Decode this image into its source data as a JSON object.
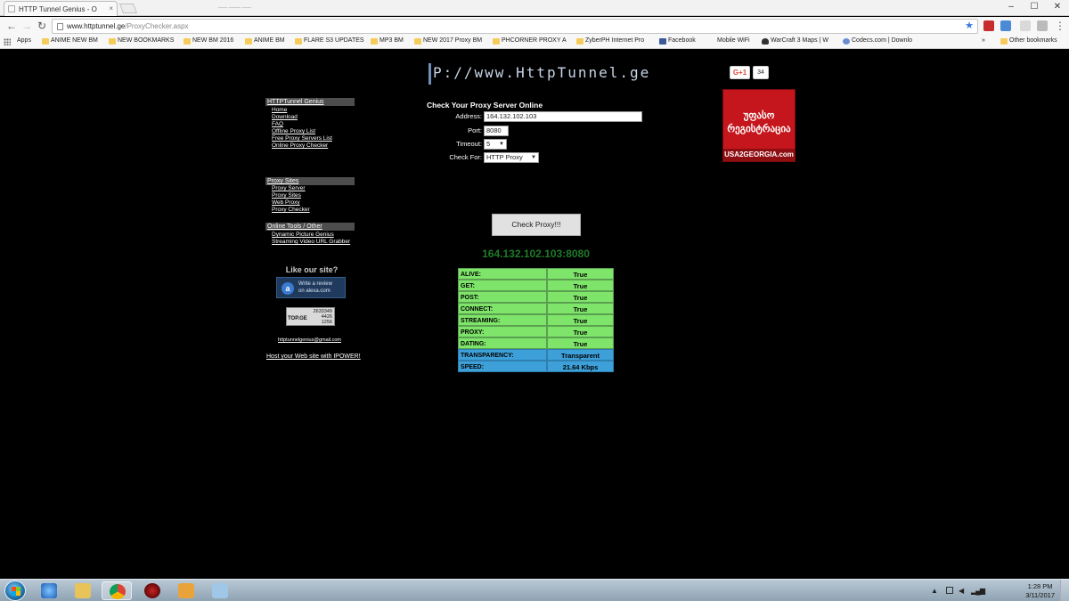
{
  "browser": {
    "tab_title": "HTTP Tunnel Genius - O",
    "tab_close": "×",
    "ghost_tab": "___ ____ ___",
    "window_min": "–",
    "window_max": "☐",
    "window_close": "✕",
    "url_host": "www.httptunnel.ge",
    "url_path": "/ProxyChecker.aspx",
    "back": "←",
    "forward": "→",
    "reload": "↻",
    "star": "★",
    "menu": "⋮"
  },
  "bookmarks": {
    "apps": "Apps",
    "items": [
      {
        "label": "ANIME NEW BM"
      },
      {
        "label": "NEW BOOKMARKS"
      },
      {
        "label": "NEW BM 2016"
      },
      {
        "label": "ANIME BM"
      },
      {
        "label": "FLARE S3 UPDATES"
      },
      {
        "label": "MP3 BM"
      },
      {
        "label": "NEW 2017 Proxy BM"
      },
      {
        "label": "PHCORNER PROXY A"
      },
      {
        "label": "ZyberPH Internet Pro"
      },
      {
        "label": "Facebook"
      },
      {
        "label": "Mobile WiFi"
      },
      {
        "label": "WarCraft 3 Maps | W"
      },
      {
        "label": "Codecs.com | Downlo"
      }
    ],
    "overflow": "»",
    "other": "Other bookmarks"
  },
  "page": {
    "logo": "P://www.HttpTunnel.ge",
    "gplus_label": "G+1",
    "gplus_count": "34",
    "ad_text": "უფასო\nრეგისტრაცია",
    "ad_footer": "USA2GEORGIA.com",
    "sidebar": {
      "sections": [
        {
          "title": "HTTPTunnel Genius",
          "links": [
            "Home",
            "Download",
            "FAQ",
            "Offline Proxy List",
            "Free Proxy Servers List",
            "Online Proxy Checker"
          ]
        },
        {
          "title": "Proxy Sites",
          "links": [
            "Proxy Server",
            "Proxy Sites",
            "Web Proxy",
            "Proxy Checker"
          ]
        },
        {
          "title": "Online Tools / Other",
          "links": [
            "Dynamic Picture Genius",
            "Streaming Video URL Grabber"
          ]
        }
      ],
      "like_title": "Like our site?",
      "alexa_text": "Write a review\non alexa.com",
      "counter_brand": "TOP.GE",
      "counter_values": "2633349\n4426\n1256",
      "email": "httptunnelgenius@gmail.com",
      "host_link": "Host your Web site with IPOWER!"
    },
    "form": {
      "title": "Check Your Proxy Server Online",
      "address_label": "Address:",
      "address_value": "164.132.102.103",
      "port_label": "Port:",
      "port_value": "8080",
      "timeout_label": "Timeout:",
      "timeout_value": "5",
      "checkfor_label": "Check For:",
      "checkfor_value": "HTTP Proxy",
      "check_button": "Check Proxy!!!"
    },
    "result_endpoint": "164.132.102.103:8080",
    "results": [
      {
        "key": "ALIVE:",
        "value": "True",
        "style": "green"
      },
      {
        "key": "GET:",
        "value": "True",
        "style": "green"
      },
      {
        "key": "POST:",
        "value": "True",
        "style": "green"
      },
      {
        "key": "CONNECT:",
        "value": "True",
        "style": "green"
      },
      {
        "key": "STREAMING:",
        "value": "True",
        "style": "green"
      },
      {
        "key": "PROXY:",
        "value": "True",
        "style": "green"
      },
      {
        "key": "DATING:",
        "value": "True",
        "style": "green"
      },
      {
        "key": "TRANSPARENCY:",
        "value": "Transparent",
        "style": "blue"
      },
      {
        "key": "SPEED:",
        "value": "21.64 Kbps",
        "style": "blue"
      }
    ]
  },
  "taskbar": {
    "time": "1:28 PM",
    "date": "3/11/2017",
    "tray_arrow": "▲",
    "apps": [
      "internet-explorer",
      "file-explorer",
      "chrome",
      "media-app",
      "video-player",
      "notepad"
    ]
  },
  "colors": {
    "result_green": "#7fe46a",
    "result_blue": "#3ea0d8",
    "endpoint_green": "#1f7a2a",
    "ad_red": "#c5161d"
  }
}
